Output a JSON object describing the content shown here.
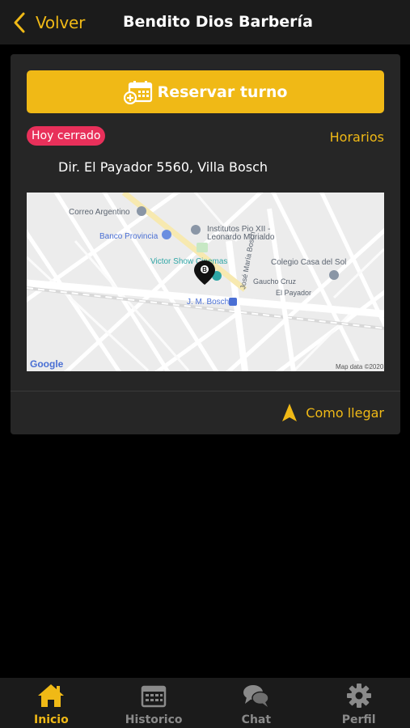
{
  "header": {
    "back_label": "Volver",
    "title": "Bendito Dios Barbería"
  },
  "card": {
    "reserve_label": "Reservar turno",
    "status_badge": "Hoy cerrado",
    "horarios_label": "Horarios",
    "address": "Dir. El Payador 5560, Villa Bosch",
    "directions_label": "Como llegar"
  },
  "map": {
    "labels": {
      "correo": "Correo Argentino",
      "banco": "Banco Provincia",
      "institutos": "Institutos Pio XII -",
      "institutos2": "Leonardo Murialdo",
      "cinema": "Victor Show Cinemas",
      "colegio": "Colegio Casa del Sol",
      "gaucho": "Gaucho Cruz",
      "payador": "El Payador",
      "jmbosch": "J. M. Bosch",
      "jose_maria": "José María Bosch",
      "google": "Google",
      "attribution": "Map data ©2020",
      "pin_letter": "B"
    }
  },
  "nav": {
    "items": [
      {
        "label": "Inicio",
        "icon": "home-icon"
      },
      {
        "label": "Historico",
        "icon": "calendar-icon"
      },
      {
        "label": "Chat",
        "icon": "chat-icon"
      },
      {
        "label": "Perfil",
        "icon": "gear-icon"
      }
    ]
  },
  "colors": {
    "accent": "#f0b916",
    "badge": "#e8305a",
    "card": "#262626",
    "bar": "#1b1b1b"
  }
}
